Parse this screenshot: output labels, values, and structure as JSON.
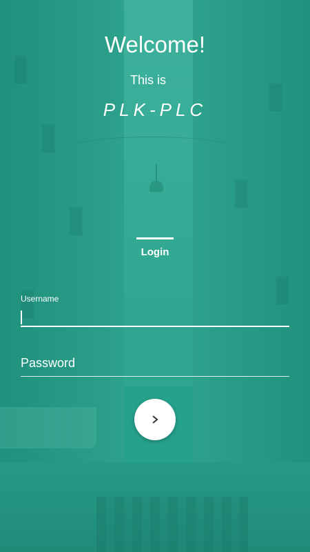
{
  "header": {
    "title": "Welcome!",
    "subtitle": "This is",
    "brand": "PLK-PLC"
  },
  "tabs": [
    {
      "label": "Login",
      "active": true
    }
  ],
  "form": {
    "username": {
      "label": "Username",
      "value": ""
    },
    "password": {
      "placeholder": "Password",
      "value": ""
    }
  },
  "actions": {
    "submit_icon": "chevron-right-icon"
  },
  "colors": {
    "accent": "#2a9f8a",
    "text": "#ffffff",
    "button": "#ffffff"
  }
}
